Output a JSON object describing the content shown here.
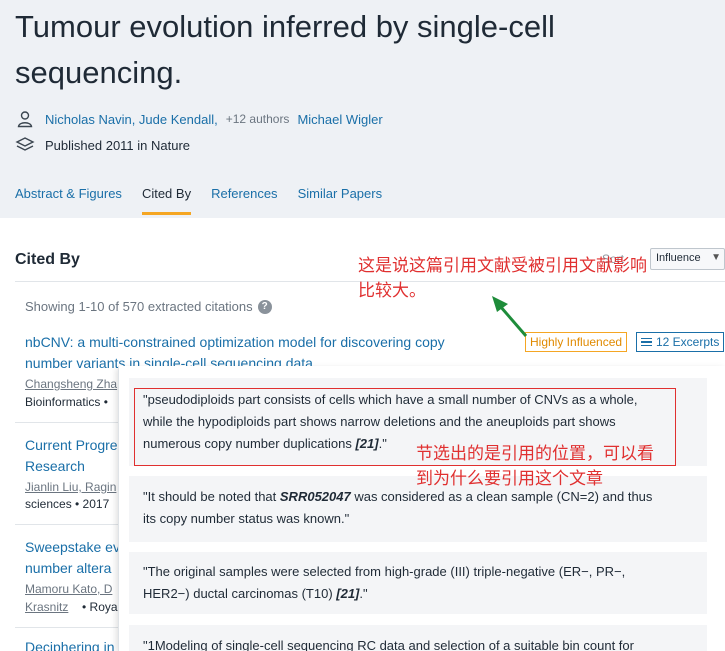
{
  "paper": {
    "title": "Tumour evolution inferred by single-cell sequencing.",
    "authors": "Nicholas Navin, Jude Kendall,",
    "more_authors": "+12 authors",
    "last_author": "Michael Wigler",
    "published": "Published 2011 in Nature"
  },
  "icons": {
    "author": "person-icon",
    "venue": "layers-icon",
    "help": "help-icon",
    "excerpts": "list-icon"
  },
  "tabs": [
    {
      "label": "Abstract & Figures",
      "active": false
    },
    {
      "label": "Cited By",
      "active": true
    },
    {
      "label": "References",
      "active": false
    },
    {
      "label": "Similar Papers",
      "active": false
    }
  ],
  "cited_by": {
    "heading": "Cited By",
    "sort_label": "Sort",
    "sort_value": "Influence",
    "count_text": "Showing 1-10 of 570 extracted citations",
    "help_glyph": "?",
    "papers": [
      {
        "title_line1": "nbCNV: a multi-constrained optimization model for discovering copy",
        "title_line2": "number variants in single-cell sequencing data",
        "authors": "Changsheng Zha",
        "venue": "Bioinformatics •",
        "badge": "Highly Influenced",
        "excerpts_label": "12 Excerpts"
      },
      {
        "title_line1": "Current Progre",
        "title_line2": "Research",
        "authors": "Jianlin Liu, Ragin",
        "venue": "sciences • 2017"
      },
      {
        "title_line1": "Sweepstake ev",
        "title_line2": "number altera",
        "authors": "Mamoru Kato, D",
        "authors_line2": "Krasnitz",
        "venue": "• Royal"
      },
      {
        "title_line1": "Deciphering in"
      }
    ]
  },
  "excerpts": [
    {
      "lines": [
        "\"pseudodiploids part consists of cells which have a small number of CNVs as a whole,",
        "while the hypodiploids part shows narrow deletions and the aneuploids part shows",
        "numerous copy number duplications "
      ],
      "ref": "[21]",
      "tail": ".\""
    },
    {
      "pre": "\"It should be noted that ",
      "bold": "SRR052047",
      "post": " was considered as a clean sample (CN=2) and thus",
      "line2": "its copy number status was known.\""
    },
    {
      "line1": "\"The original samples were selected from high-grade (III) triple-negative (ER−, PR−,",
      "line2_pre": "HER2−) ductal carcinomas (T10) ",
      "ref": "[21]",
      "tail": ".\""
    },
    {
      "line1": "\"1Modeling of single-cell sequencing RC data and selection of a suitable bin count for"
    }
  ],
  "annotations": {
    "top_line1": "这是说这篇引用文献受被引用文献影响",
    "top_line2": "比较大。",
    "mid_line1": "节选出的是引用的位置，可以看",
    "mid_line2": "到为什么要引用这个文章"
  },
  "colors": {
    "link": "#1a6fa8",
    "accent": "#f5a623",
    "annotation": "#e03030"
  }
}
